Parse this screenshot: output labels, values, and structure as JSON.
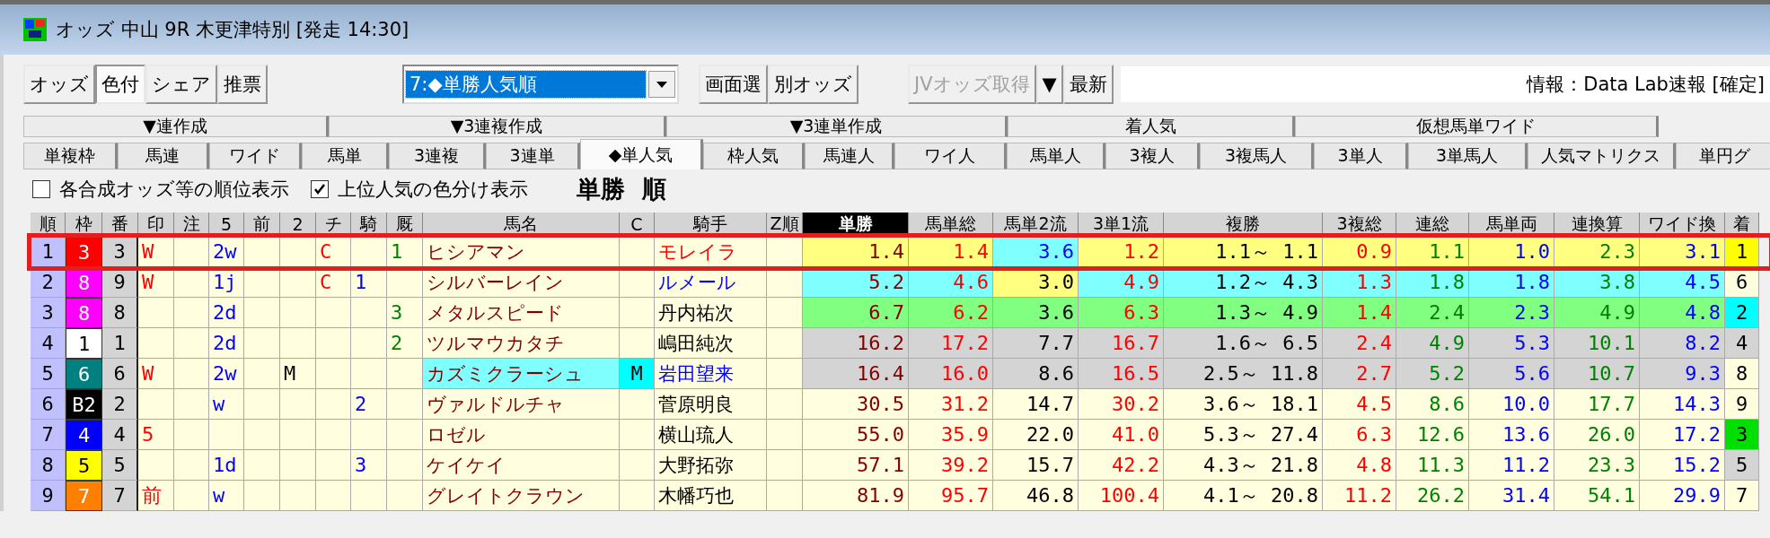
{
  "window": {
    "title": "オッズ 中山 9R 木更津特別 [発走 14:30]"
  },
  "toolbar": {
    "mode_buttons": [
      {
        "label": "オッズ",
        "selected": false
      },
      {
        "label": "色付",
        "selected": true
      },
      {
        "label": "シェア",
        "selected": false
      },
      {
        "label": "推票",
        "selected": false
      }
    ],
    "view_select": {
      "value": "7:◆単勝人気順"
    },
    "screen_buttons": [
      {
        "label": "画面選",
        "disabled": false
      },
      {
        "label": "別オッズ",
        "disabled": false
      }
    ],
    "fetch_buttons": [
      {
        "label": "JVオッズ取得",
        "disabled": true
      },
      {
        "label": "▼",
        "disabled": false
      },
      {
        "label": "最新",
        "disabled": false
      }
    ],
    "info_field": {
      "value": "情報：Data Lab速報 [確定]"
    }
  },
  "tab_groups": [
    {
      "label": "▼連作成"
    },
    {
      "label": "▼3連複作成"
    },
    {
      "label": "▼3連単作成"
    },
    {
      "label": "着人気"
    },
    {
      "label": "仮想馬単ワイド"
    }
  ],
  "tabs": [
    {
      "label": "単複枠",
      "selected": false
    },
    {
      "label": "馬連",
      "selected": false
    },
    {
      "label": "ワイド",
      "selected": false
    },
    {
      "label": "馬単",
      "selected": false
    },
    {
      "label": "3連複",
      "selected": false
    },
    {
      "label": "3連単",
      "selected": false
    },
    {
      "label": "◆単人気",
      "selected": true
    },
    {
      "label": "枠人気",
      "selected": false
    },
    {
      "label": "馬連人",
      "selected": false
    },
    {
      "label": "ワイ人",
      "selected": false
    },
    {
      "label": "馬単人",
      "selected": false
    },
    {
      "label": "3複人",
      "selected": false
    },
    {
      "label": "3複馬人",
      "selected": false
    },
    {
      "label": "3単人",
      "selected": false
    },
    {
      "label": "3単馬人",
      "selected": false
    },
    {
      "label": "人気マトリクス",
      "selected": false
    },
    {
      "label": "単円グ",
      "selected": false
    }
  ],
  "options": [
    {
      "label": "各合成オッズ等の順位表示",
      "checked": false
    },
    {
      "label": "上位人気の色分け表示",
      "checked": true
    }
  ],
  "heading": "単勝 順",
  "table": {
    "columns": [
      {
        "label": "順",
        "selected": false
      },
      {
        "label": "枠",
        "selected": false
      },
      {
        "label": "番",
        "selected": false
      },
      {
        "label": "印",
        "selected": false
      },
      {
        "label": "注",
        "selected": false
      },
      {
        "label": "5",
        "selected": false
      },
      {
        "label": "前",
        "selected": false
      },
      {
        "label": "2",
        "selected": false
      },
      {
        "label": "チ",
        "selected": false
      },
      {
        "label": "騎",
        "selected": false
      },
      {
        "label": "厩",
        "selected": false
      },
      {
        "label": "馬名",
        "selected": false
      },
      {
        "label": "C",
        "selected": false
      },
      {
        "label": "騎手",
        "selected": false
      },
      {
        "label": "Z順",
        "selected": false
      },
      {
        "label": "単勝",
        "selected": true
      },
      {
        "label": "馬単総",
        "selected": false
      },
      {
        "label": "馬単2流",
        "selected": false
      },
      {
        "label": "3単1流",
        "selected": false
      },
      {
        "label": "複勝",
        "selected": false
      },
      {
        "label": "3複総",
        "selected": false
      },
      {
        "label": "連総",
        "selected": false
      },
      {
        "label": "馬単両",
        "selected": false
      },
      {
        "label": "連換算",
        "selected": false
      },
      {
        "label": "ワイド換",
        "selected": false
      },
      {
        "label": "着",
        "selected": false
      }
    ],
    "rows": [
      {
        "selected": true,
        "cells": [
          {
            "text": "1"
          },
          {
            "text": "3",
            "color": "#ffffff",
            "fill": {
              "color": "#ff0000"
            }
          },
          {
            "text": "3"
          },
          {
            "text": "W",
            "color": "#ff0000"
          },
          null,
          {
            "text": "2w",
            "color": "#0000ff"
          },
          null,
          null,
          {
            "text": "C",
            "color": "#ff0000"
          },
          null,
          {
            "text": "1",
            "color": "#008000"
          },
          {
            "text": "ヒシアマン",
            "color": "#800000"
          },
          null,
          {
            "text": "モレイラ",
            "color": "#ff0000"
          },
          null,
          {
            "text": "1.4",
            "color": "#800000",
            "fill": {
              "color": "#ffff80"
            }
          },
          {
            "text": "1.4",
            "color": "#ff0000",
            "fill": {
              "color": "#ffff80"
            }
          },
          {
            "text": "3.6",
            "color": "#0000ff",
            "fill": {
              "color": "#80ffff"
            }
          },
          {
            "text": "1.2",
            "color": "#ff0000",
            "fill": {
              "color": "#ffff80"
            }
          },
          {
            "text": "1.1～ 1.1",
            "fill": {
              "color": "#ffff80"
            }
          },
          {
            "text": "0.9",
            "color": "#ff0000",
            "fill": {
              "color": "#ffff80"
            }
          },
          {
            "text": "1.1",
            "color": "#008000",
            "fill": {
              "color": "#ffff80"
            }
          },
          {
            "text": "1.0",
            "color": "#0000ff",
            "fill": {
              "color": "#ffff80"
            }
          },
          {
            "text": "2.3",
            "color": "#008000",
            "fill": {
              "color": "#ffff80"
            }
          },
          {
            "text": "3.1",
            "color": "#0000ff",
            "fill": {
              "color": "#ffff80"
            }
          },
          {
            "text": "1",
            "fill": {
              "color": "#ffff00"
            }
          }
        ]
      },
      {
        "selected": false,
        "cells": [
          {
            "text": "2"
          },
          {
            "text": "8",
            "color": "#ffffff",
            "fill": {
              "color": "#ff00ff"
            }
          },
          {
            "text": "9"
          },
          {
            "text": "W",
            "color": "#ff0000"
          },
          null,
          {
            "text": "1j",
            "color": "#0000ff"
          },
          null,
          null,
          {
            "text": "C",
            "color": "#ff0000"
          },
          {
            "text": "1",
            "color": "#0000ff"
          },
          null,
          {
            "text": "シルバーレイン",
            "color": "#800000"
          },
          null,
          {
            "text": "ルメール",
            "color": "#0000ff"
          },
          null,
          {
            "text": "5.2",
            "color": "#800000",
            "fill": {
              "color": "#80ffff"
            }
          },
          {
            "text": "4.6",
            "color": "#ff0000",
            "fill": {
              "color": "#80ffff"
            }
          },
          {
            "text": "3.0",
            "fill": {
              "color": "#ffff80"
            }
          },
          {
            "text": "4.9",
            "color": "#ff0000",
            "fill": {
              "color": "#80ffff"
            }
          },
          {
            "text": "1.2～ 4.3",
            "fill": {
              "color": "#80ffff"
            }
          },
          {
            "text": "1.3",
            "color": "#ff0000",
            "fill": {
              "color": "#80ffff"
            }
          },
          {
            "text": "1.8",
            "color": "#008000",
            "fill": {
              "color": "#80ffff"
            }
          },
          {
            "text": "1.8",
            "color": "#0000ff",
            "fill": {
              "color": "#80ffff"
            }
          },
          {
            "text": "3.8",
            "color": "#008000",
            "fill": {
              "color": "#80ffff"
            }
          },
          {
            "text": "4.5",
            "color": "#0000ff",
            "fill": {
              "color": "#80ffff"
            }
          },
          {
            "text": "6"
          }
        ]
      },
      {
        "selected": false,
        "cells": [
          {
            "text": "3"
          },
          {
            "text": "8",
            "color": "#ffffff",
            "fill": {
              "color": "#ff00ff"
            }
          },
          {
            "text": "8"
          },
          null,
          null,
          {
            "text": "2d",
            "color": "#0000ff"
          },
          null,
          null,
          null,
          null,
          {
            "text": "3",
            "color": "#008000"
          },
          {
            "text": "メタルスピード",
            "color": "#800000"
          },
          null,
          {
            "text": "丹内祐次"
          },
          null,
          {
            "text": "6.7",
            "color": "#800000",
            "fill": {
              "color": "#80ff80"
            }
          },
          {
            "text": "6.2",
            "color": "#ff0000",
            "fill": {
              "color": "#80ff80"
            }
          },
          {
            "text": "3.6",
            "fill": {
              "color": "#80ff80"
            }
          },
          {
            "text": "6.3",
            "color": "#ff0000",
            "fill": {
              "color": "#80ff80"
            }
          },
          {
            "text": "1.3～ 4.9",
            "fill": {
              "color": "#80ff80"
            }
          },
          {
            "text": "1.4",
            "color": "#ff0000",
            "fill": {
              "color": "#80ff80"
            }
          },
          {
            "text": "2.4",
            "color": "#008000",
            "fill": {
              "color": "#80ff80"
            }
          },
          {
            "text": "2.3",
            "color": "#0000ff",
            "fill": {
              "color": "#80ff80"
            }
          },
          {
            "text": "4.9",
            "color": "#008000",
            "fill": {
              "color": "#80ff80"
            }
          },
          {
            "text": "4.8",
            "color": "#0000ff",
            "fill": {
              "color": "#80ff80"
            }
          },
          {
            "text": "2",
            "fill": {
              "color": "#00ffff"
            }
          }
        ]
      },
      {
        "selected": false,
        "cells": [
          {
            "text": "4"
          },
          {
            "text": "1",
            "fill": {
              "color": "#ffffff"
            }
          },
          {
            "text": "1"
          },
          null,
          null,
          {
            "text": "2d",
            "color": "#0000ff"
          },
          null,
          null,
          null,
          null,
          {
            "text": "2",
            "color": "#008000"
          },
          {
            "text": "ツルマウカタチ",
            "color": "#800000"
          },
          null,
          {
            "text": "嶋田純次"
          },
          null,
          {
            "text": "16.2",
            "color": "#800000",
            "fill": {
              "color": "#d4d4d4"
            }
          },
          {
            "text": "17.2",
            "color": "#ff0000",
            "fill": {
              "color": "#d4d4d4"
            }
          },
          {
            "text": "7.7",
            "fill": {
              "color": "#d4d4d4"
            }
          },
          {
            "text": "16.7",
            "color": "#ff0000",
            "fill": {
              "color": "#d4d4d4"
            }
          },
          {
            "text": "1.6～ 6.5",
            "fill": {
              "color": "#d4d4d4"
            }
          },
          {
            "text": "2.4",
            "color": "#ff0000",
            "fill": {
              "color": "#d4d4d4"
            }
          },
          {
            "text": "4.9",
            "color": "#008000",
            "fill": {
              "color": "#d4d4d4"
            }
          },
          {
            "text": "5.3",
            "color": "#0000ff",
            "fill": {
              "color": "#d4d4d4"
            }
          },
          {
            "text": "10.1",
            "color": "#008000",
            "fill": {
              "color": "#d4d4d4"
            }
          },
          {
            "text": "8.2",
            "color": "#0000ff",
            "fill": {
              "color": "#d4d4d4"
            }
          },
          {
            "text": "4",
            "fill": {
              "color": "#d4d4d4"
            }
          }
        ]
      },
      {
        "selected": false,
        "cells": [
          {
            "text": "5"
          },
          {
            "text": "6",
            "color": "#ffffff",
            "fill": {
              "color": "#008080"
            }
          },
          {
            "text": "6"
          },
          {
            "text": "W",
            "color": "#ff0000"
          },
          null,
          {
            "text": "2w",
            "color": "#0000ff"
          },
          null,
          {
            "text": "M"
          },
          null,
          null,
          null,
          {
            "text": "カズミクラーシュ",
            "color": "#800000",
            "fill": {
              "color": "#80ffff"
            }
          },
          {
            "text": "M",
            "fill": {
              "color": "#00ffff"
            }
          },
          {
            "text": "岩田望来",
            "color": "#0000ff"
          },
          null,
          {
            "text": "16.4",
            "color": "#800000",
            "fill": {
              "color": "#d4d4d4"
            }
          },
          {
            "text": "16.0",
            "color": "#ff0000",
            "fill": {
              "color": "#d4d4d4"
            }
          },
          {
            "text": "8.6",
            "fill": {
              "color": "#d4d4d4"
            }
          },
          {
            "text": "16.5",
            "color": "#ff0000",
            "fill": {
              "color": "#d4d4d4"
            }
          },
          {
            "text": "2.5～ 11.8",
            "fill": {
              "color": "#d4d4d4"
            }
          },
          {
            "text": "2.7",
            "color": "#ff0000",
            "fill": {
              "color": "#d4d4d4"
            }
          },
          {
            "text": "5.2",
            "color": "#008000",
            "fill": {
              "color": "#d4d4d4"
            }
          },
          {
            "text": "5.6",
            "color": "#0000ff",
            "fill": {
              "color": "#d4d4d4"
            }
          },
          {
            "text": "10.7",
            "color": "#008000",
            "fill": {
              "color": "#d4d4d4"
            }
          },
          {
            "text": "9.3",
            "color": "#0000ff",
            "fill": {
              "color": "#d4d4d4"
            }
          },
          {
            "text": "8"
          }
        ]
      },
      {
        "selected": false,
        "cells": [
          {
            "text": "6"
          },
          {
            "text": "B2",
            "color": "#ffffff",
            "fill": {
              "color": "#000000"
            }
          },
          {
            "text": "2"
          },
          null,
          null,
          {
            "text": "w",
            "color": "#0000ff"
          },
          null,
          null,
          null,
          {
            "text": "2",
            "color": "#0000ff"
          },
          null,
          {
            "text": "ヴァルドルチャ",
            "color": "#800000"
          },
          null,
          {
            "text": "菅原明良"
          },
          null,
          {
            "text": "30.5",
            "color": "#800000"
          },
          {
            "text": "31.2",
            "color": "#ff0000"
          },
          {
            "text": "14.7"
          },
          {
            "text": "30.2",
            "color": "#ff0000"
          },
          {
            "text": "3.6～ 18.1"
          },
          {
            "text": "4.5",
            "color": "#ff0000"
          },
          {
            "text": "8.6",
            "color": "#008000"
          },
          {
            "text": "10.0",
            "color": "#0000ff"
          },
          {
            "text": "17.7",
            "color": "#008000"
          },
          {
            "text": "14.3",
            "color": "#0000ff"
          },
          {
            "text": "9"
          }
        ]
      },
      {
        "selected": false,
        "cells": [
          {
            "text": "7"
          },
          {
            "text": "4",
            "color": "#ffffff",
            "fill": {
              "color": "#0000ff"
            }
          },
          {
            "text": "4"
          },
          {
            "text": "5",
            "color": "#ff0000"
          },
          null,
          null,
          null,
          null,
          null,
          null,
          null,
          {
            "text": "ロゼル",
            "color": "#800000"
          },
          null,
          {
            "text": "横山琉人"
          },
          null,
          {
            "text": "55.0",
            "color": "#800000"
          },
          {
            "text": "35.9",
            "color": "#ff0000"
          },
          {
            "text": "22.0"
          },
          {
            "text": "41.0",
            "color": "#ff0000"
          },
          {
            "text": "5.3～ 27.4"
          },
          {
            "text": "6.3",
            "color": "#ff0000"
          },
          {
            "text": "12.6",
            "color": "#008000"
          },
          {
            "text": "13.6",
            "color": "#0000ff"
          },
          {
            "text": "26.0",
            "color": "#008000"
          },
          {
            "text": "17.2",
            "color": "#0000ff"
          },
          {
            "text": "3",
            "fill": {
              "color": "#00e000"
            }
          }
        ]
      },
      {
        "selected": false,
        "cells": [
          {
            "text": "8"
          },
          {
            "text": "5",
            "fill": {
              "color": "#ffff00"
            }
          },
          {
            "text": "5"
          },
          null,
          null,
          {
            "text": "1d",
            "color": "#0000ff"
          },
          null,
          null,
          null,
          {
            "text": "3",
            "color": "#0000ff"
          },
          null,
          {
            "text": "ケイケイ",
            "color": "#800000"
          },
          null,
          {
            "text": "大野拓弥"
          },
          null,
          {
            "text": "57.1",
            "color": "#800000"
          },
          {
            "text": "39.2",
            "color": "#ff0000"
          },
          {
            "text": "15.7"
          },
          {
            "text": "42.2",
            "color": "#ff0000"
          },
          {
            "text": "4.3～ 21.8"
          },
          {
            "text": "4.8",
            "color": "#ff0000"
          },
          {
            "text": "11.3",
            "color": "#008000"
          },
          {
            "text": "11.2",
            "color": "#0000ff"
          },
          {
            "text": "23.3",
            "color": "#008000"
          },
          {
            "text": "15.2",
            "color": "#0000ff"
          },
          {
            "text": "5",
            "fill": {
              "color": "#d4d4d4"
            }
          }
        ]
      },
      {
        "selected": false,
        "cells": [
          {
            "text": "9"
          },
          {
            "text": "7",
            "color": "#ffffff",
            "fill": {
              "color": "#ff8000"
            }
          },
          {
            "text": "7"
          },
          {
            "text": "前",
            "color": "#ff0000"
          },
          null,
          {
            "text": "w",
            "color": "#0000ff"
          },
          null,
          null,
          null,
          null,
          null,
          {
            "text": "グレイトクラウン",
            "color": "#800000"
          },
          null,
          {
            "text": "木幡巧也"
          },
          null,
          {
            "text": "81.9",
            "color": "#800000"
          },
          {
            "text": "95.7",
            "color": "#ff0000"
          },
          {
            "text": "46.8"
          },
          {
            "text": "100.4",
            "color": "#ff0000"
          },
          {
            "text": "4.1～ 20.8"
          },
          {
            "text": "11.2",
            "color": "#ff0000"
          },
          {
            "text": "26.2",
            "color": "#008000"
          },
          {
            "text": "31.4",
            "color": "#0000ff"
          },
          {
            "text": "54.1",
            "color": "#008000"
          },
          {
            "text": "29.9",
            "color": "#0000ff"
          },
          {
            "text": "7"
          }
        ]
      }
    ]
  }
}
